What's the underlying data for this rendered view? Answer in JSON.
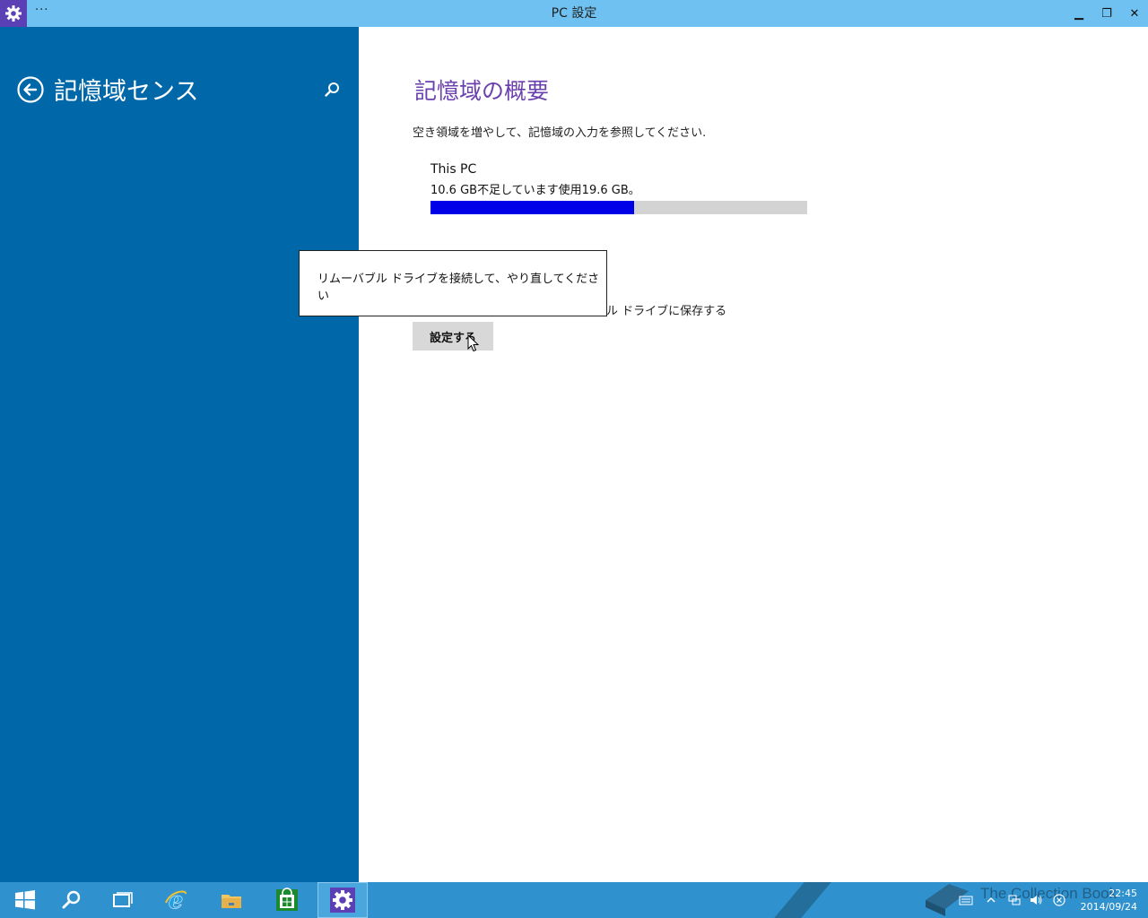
{
  "window": {
    "title": "PC 設定",
    "menu_label": "···",
    "min_label": "▁",
    "max_label": "❐",
    "close_label": "✕"
  },
  "sidebar": {
    "title": "記憶域センス"
  },
  "main": {
    "heading": "記憶域の概要",
    "description": "空き領域を増やして、記憶域の入力を参照してください.",
    "drive": {
      "name": "This PC",
      "usage_text": "10.6 GB不足しています使用19.6 GB。",
      "used_fraction": 0.54
    },
    "save_location_text": "ル ドライブに保存する",
    "set_button_label": "設定する"
  },
  "popup": {
    "message": "リムーバブル ドライブを接続して、やり直してください"
  },
  "taskbar": {
    "items": [
      "start-button",
      "search",
      "task-view",
      "internet-explorer",
      "file-explorer",
      "store",
      "pc-settings"
    ],
    "watermark": "The Collection Book",
    "time": "22:45",
    "date": "2014/09/24"
  },
  "colors": {
    "titlebar": "#6ec1f0",
    "sidebar": "#0068a8",
    "heading": "#6a3fae",
    "usage_fill": "#0000e8",
    "taskbar": "#2f92cf"
  }
}
